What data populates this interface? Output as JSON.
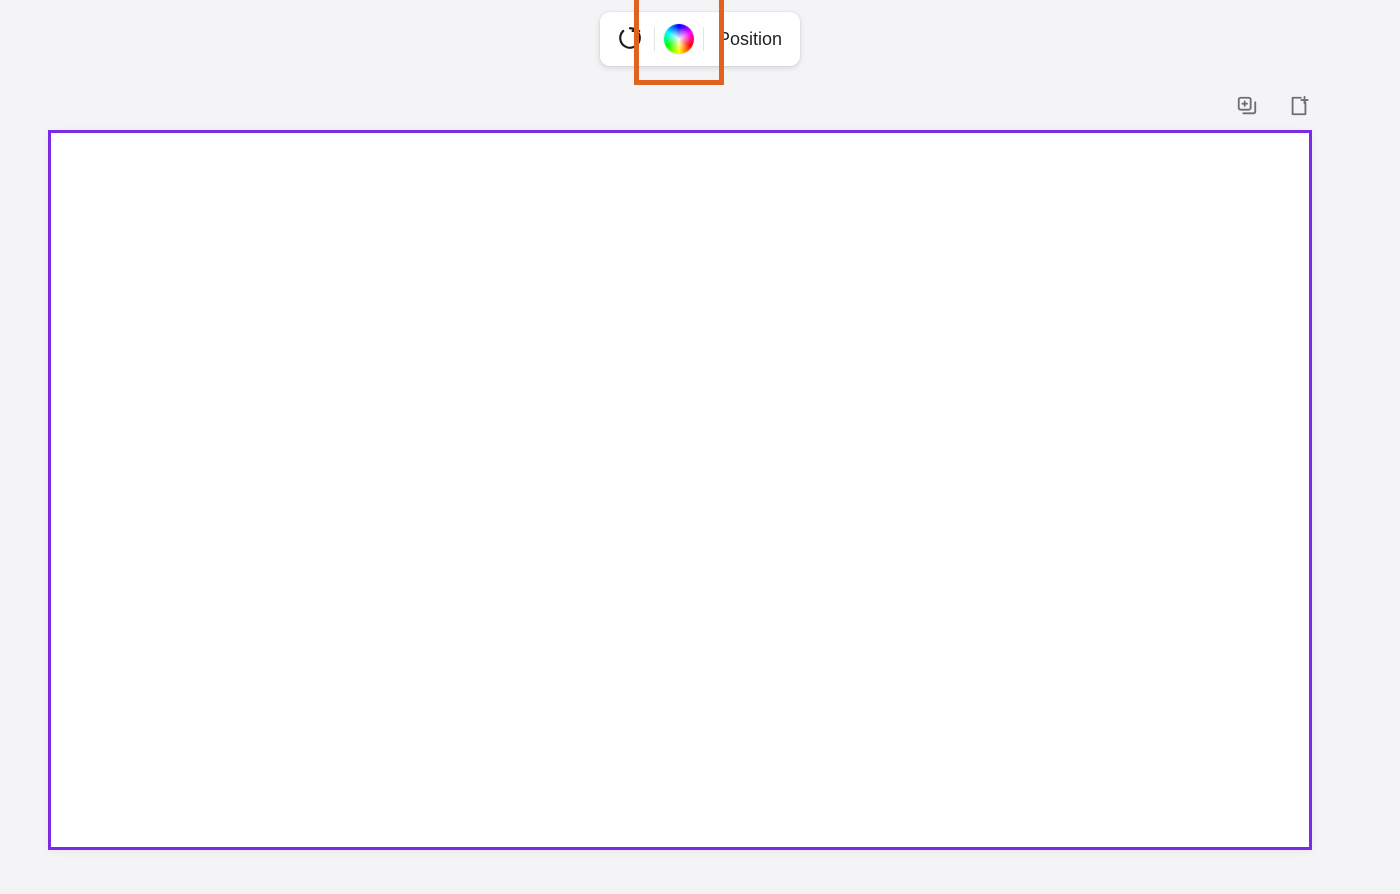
{
  "toolbar": {
    "position_label": "Position"
  },
  "colors": {
    "selection_border": "#7c2ae8",
    "highlight_border": "#e0621e",
    "canvas_bg": "#ffffff",
    "page_bg": "#f4f4f6"
  },
  "icons": {
    "refresh": "refresh-plus-icon",
    "color_picker": "color-wheel-icon",
    "duplicate": "duplicate-page-icon",
    "add_page": "add-page-icon"
  }
}
